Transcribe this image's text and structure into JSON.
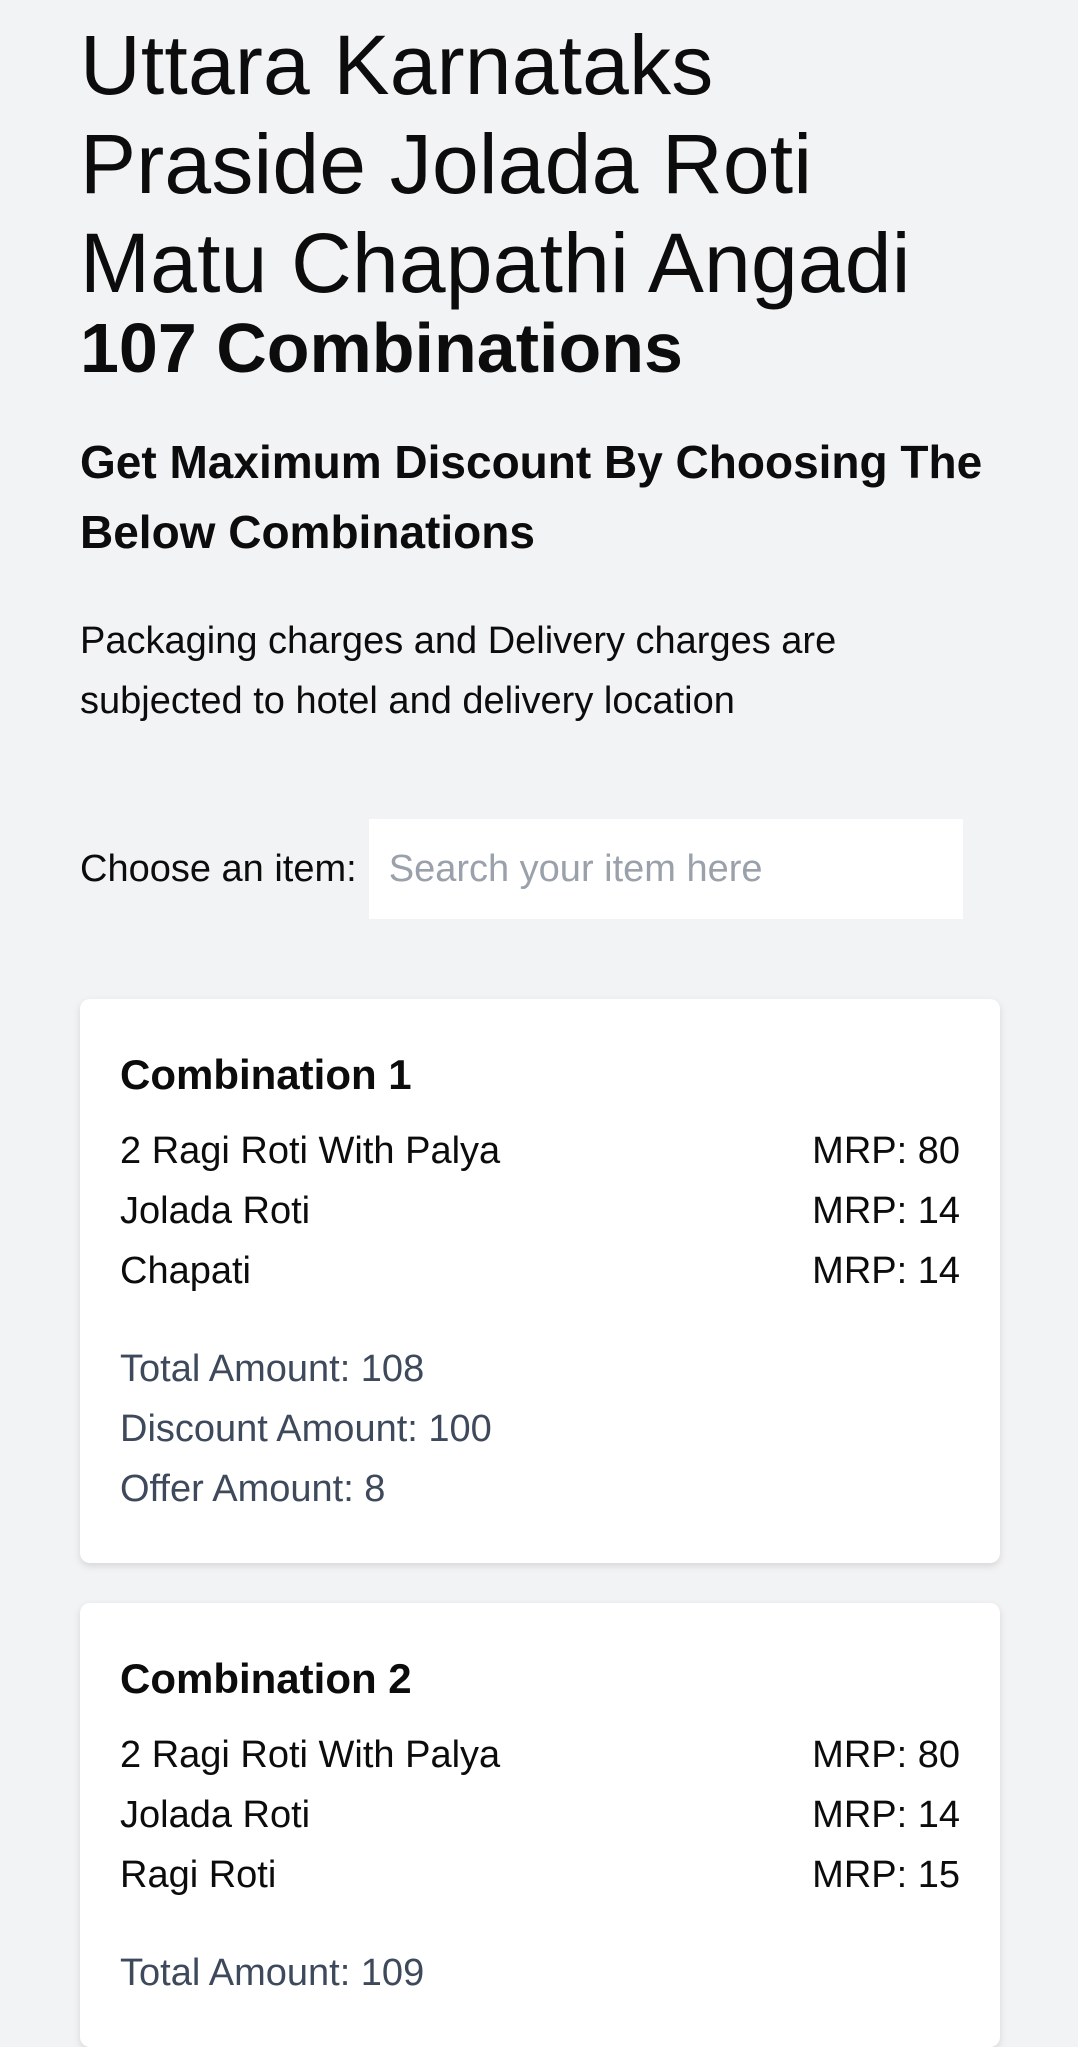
{
  "header": {
    "store_name": "Uttara Karnataks Praside Jolada Roti Matu Chapathi Angadi",
    "combinations_count": "107 Combinations",
    "subtitle": "Get Maximum Discount By Choosing The Below Combinations",
    "note": "Packaging charges and Delivery charges are subjected to hotel and delivery location"
  },
  "search": {
    "label": "Choose an item:",
    "placeholder": "Search your item here",
    "value": ""
  },
  "combinations": [
    {
      "title": "Combination 1",
      "items": [
        {
          "name": "2 Ragi Roti With Palya",
          "mrp": "MRP: 80"
        },
        {
          "name": "Jolada Roti",
          "mrp": "MRP: 14"
        },
        {
          "name": "Chapati",
          "mrp": "MRP: 14"
        }
      ],
      "total": "Total Amount: 108",
      "discount": "Discount Amount: 100",
      "offer": "Offer Amount: 8"
    },
    {
      "title": "Combination 2",
      "items": [
        {
          "name": "2 Ragi Roti With Palya",
          "mrp": "MRP: 80"
        },
        {
          "name": "Jolada Roti",
          "mrp": "MRP: 14"
        },
        {
          "name": "Ragi Roti",
          "mrp": "MRP: 15"
        }
      ],
      "total": "Total Amount: 109"
    }
  ]
}
